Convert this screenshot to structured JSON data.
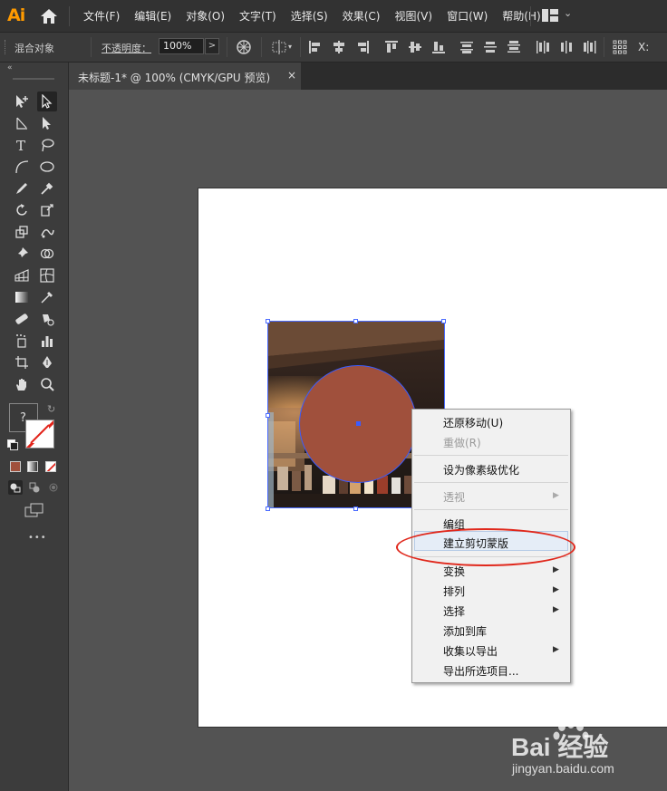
{
  "app": {
    "logo": "Ai"
  },
  "menubar": {
    "items": [
      "文件(F)",
      "编辑(E)",
      "对象(O)",
      "文字(T)",
      "选择(S)",
      "效果(C)",
      "视图(V)",
      "窗口(W)",
      "帮助(H)"
    ]
  },
  "control_bar": {
    "selection_label": "混合对象",
    "opacity_label": "不透明度：",
    "opacity_value": "100%",
    "x_label": "X:"
  },
  "document_tab": {
    "title": "未标题-1* @ 100% (CMYK/GPU 预览)",
    "close": "×"
  },
  "toolbar": {
    "fill_unknown": "?",
    "more": "•••"
  },
  "context_menu": {
    "items": [
      {
        "label": "还原移动(U)",
        "enabled": true,
        "submenu": false
      },
      {
        "label": "重做(R)",
        "enabled": false,
        "submenu": false
      },
      {
        "label": "设为像素级优化",
        "enabled": true,
        "submenu": false
      },
      {
        "label": "透视",
        "enabled": false,
        "submenu": true
      },
      {
        "label": "编组",
        "enabled": true,
        "submenu": false
      },
      {
        "label": "建立剪切蒙版",
        "enabled": true,
        "submenu": false,
        "highlighted": true
      },
      {
        "label": "变换",
        "enabled": true,
        "submenu": true
      },
      {
        "label": "排列",
        "enabled": true,
        "submenu": true
      },
      {
        "label": "选择",
        "enabled": true,
        "submenu": true
      },
      {
        "label": "添加到库",
        "enabled": true,
        "submenu": false
      },
      {
        "label": "收集以导出",
        "enabled": true,
        "submenu": true
      },
      {
        "label": "导出所选项目...",
        "enabled": true,
        "submenu": false
      }
    ]
  },
  "colors": {
    "circle_fill": "#a0503c",
    "selection": "#4a6bff",
    "annotation": "#e0281c",
    "logo": "#ff9a00"
  },
  "watermark": {
    "brand": "Bai 经验",
    "url": "jingyan.baidu.com"
  }
}
